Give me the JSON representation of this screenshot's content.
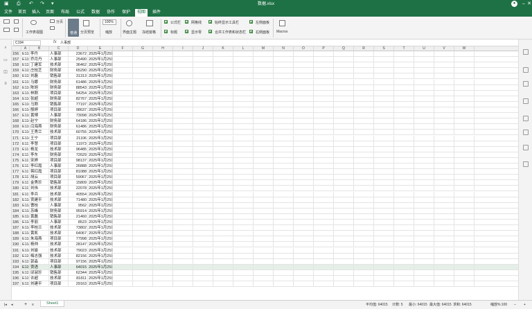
{
  "window": {
    "title": "数据.xlsx"
  },
  "menu": {
    "items": [
      "文件",
      "首页",
      "插入",
      "页面",
      "布局",
      "公式",
      "数据",
      "协作",
      "保护",
      "视图",
      "插件"
    ],
    "active_index": 9
  },
  "ribbon": {
    "labels": {
      "workbook_view": "工作表视图",
      "page_break": "分页",
      "normal": "普通",
      "page_layout": "分页预览",
      "zoom_value": "100%",
      "zoom": "缩放",
      "interface_theme": "界面主题",
      "freeze": "冻结窗格",
      "macros": "Macros"
    },
    "checks": [
      "公式栏",
      "网格线",
      "始终显示工具栏",
      "左侧面板",
      "标题",
      "显示零",
      "合并工作表和状态栏",
      "右侧面板"
    ]
  },
  "formula_bar": {
    "cell_ref": "C194",
    "fx": "fx",
    "value": "人事部"
  },
  "columns": [
    "A",
    "B",
    "C",
    "D",
    "E",
    "F",
    "G",
    "H",
    "I",
    "J",
    "K",
    "L",
    "M",
    "N",
    "O",
    "P",
    "Q",
    "R",
    "S",
    "T",
    "U",
    "V",
    "W"
  ],
  "rows": [
    [
      "156",
      "E1154",
      "李丹",
      "人事部",
      "23672",
      "2025年1月25日"
    ],
    [
      "157",
      "E1155",
      "乔月丹",
      "人事部",
      "25490",
      "2025年1月25日"
    ],
    [
      "158",
      "E1156",
      "丁建军",
      "技术部",
      "36462",
      "2025年1月25日"
    ],
    [
      "159",
      "E1157",
      "庄桂芝",
      "财务部",
      "65290",
      "2025年1月25日"
    ],
    [
      "160",
      "E1158",
      "刘磊",
      "销售部",
      "31313",
      "2025年1月25日"
    ],
    [
      "161",
      "E1159",
      "马娜",
      "财务部",
      "61486",
      "2025年1月25日"
    ],
    [
      "162",
      "E1160",
      "陈旭",
      "财务部",
      "88543",
      "2025年1月25日"
    ],
    [
      "163",
      "E1161",
      "林刚",
      "项目部",
      "54254",
      "2025年1月25日"
    ],
    [
      "164",
      "E1162",
      "张超",
      "财务部",
      "82767",
      "2025年1月25日"
    ],
    [
      "165",
      "E1163",
      "马刚",
      "销售部",
      "77197",
      "2025年1月25日"
    ],
    [
      "166",
      "E1164",
      "殷婷",
      "项目部",
      "98637",
      "2025年1月25日"
    ],
    [
      "167",
      "E1165",
      "黄博",
      "人事部",
      "73098",
      "2025年1月25日"
    ],
    [
      "168",
      "E1166",
      "赵宁",
      "财务部",
      "64186",
      "2025年1月25日"
    ],
    [
      "169",
      "E1167",
      "闫海燕",
      "财务部",
      "61486",
      "2025年1月25日"
    ],
    [
      "170",
      "E1168",
      "王秀兰",
      "技术部",
      "60755",
      "2025年1月25日"
    ],
    [
      "171",
      "E1169",
      "王宁",
      "项目部",
      "21106",
      "2025年1月25日"
    ],
    [
      "172",
      "E1170",
      "李慧",
      "项目部",
      "11973",
      "2025年1月25日"
    ],
    [
      "173",
      "E1171",
      "杨龙",
      "技术部",
      "96485",
      "2025年1月25日"
    ],
    [
      "174",
      "E1172",
      "李东",
      "财务部",
      "72629",
      "2025年1月25日"
    ],
    [
      "175",
      "E1173",
      "宋婷",
      "项目部",
      "98137",
      "2025年1月25日"
    ],
    [
      "176",
      "E1174",
      "李红霞",
      "人事部",
      "26888",
      "2025年1月25日"
    ],
    [
      "177",
      "E1175",
      "蒋红霞",
      "项目部",
      "81088",
      "2025年1月25日"
    ],
    [
      "178",
      "E1176",
      "胡云",
      "项目部",
      "59067",
      "2025年1月25日"
    ],
    [
      "179",
      "E1177",
      "金秀珍",
      "销售部",
      "15809",
      "2025年1月25日"
    ],
    [
      "180",
      "E1178",
      "刘伟",
      "技术部",
      "22078",
      "2025年1月25日"
    ],
    [
      "181",
      "E1179",
      "李兵",
      "技术部",
      "40554",
      "2025年1月25日"
    ],
    [
      "182",
      "E1180",
      "贾建平",
      "技术部",
      "71480",
      "2025年1月25日"
    ],
    [
      "183",
      "E1181",
      "曹桂",
      "人事部",
      "9562",
      "2025年1月25日"
    ],
    [
      "184",
      "E1182",
      "苏峰",
      "财务部",
      "95914",
      "2025年1月25日"
    ],
    [
      "185",
      "E1183",
      "黄磊",
      "销售部",
      "21460",
      "2025年1月25日"
    ],
    [
      "186",
      "E1184",
      "李丽",
      "人事部",
      "8523",
      "2025年1月25日"
    ],
    [
      "187",
      "E1185",
      "李桂兰",
      "技术部",
      "73802",
      "2025年1月25日"
    ],
    [
      "188",
      "E1186",
      "黄凯",
      "技术部",
      "64067",
      "2025年1月25日"
    ],
    [
      "189",
      "E1187",
      "朱海燕",
      "项目部",
      "77998",
      "2025年1月25日"
    ],
    [
      "190",
      "E1188",
      "杨帅",
      "技术部",
      "28147",
      "2025年1月25日"
    ],
    [
      "191",
      "E1189",
      "刘瑜",
      "技术部",
      "79023",
      "2025年1月25日"
    ],
    [
      "192",
      "E1190",
      "梅志强",
      "技术部",
      "82156",
      "2025年1月25日"
    ],
    [
      "193",
      "E1191",
      "郭淼",
      "项目部",
      "97156",
      "2025年1月25日"
    ],
    [
      "194",
      "E1192",
      "贾语",
      "人事部",
      "64015",
      "2025年1月25日"
    ],
    [
      "195",
      "E1193",
      "邱淑珍",
      "销售部",
      "62344",
      "2025年1月25日"
    ],
    [
      "196",
      "E1194",
      "许超",
      "技术部",
      "81811",
      "2025年1月25日"
    ],
    [
      "197",
      "E1195",
      "刘建平",
      "项目部",
      "29163",
      "2025年1月25日"
    ]
  ],
  "selected_row": "194",
  "status": {
    "sheet": "Sheet1",
    "sum": "平均值: 64015",
    "count": "计数: 5",
    "min": "最小: 64015",
    "max": "最大值: 64015",
    "total": "求和: 64015",
    "zoom": "缩放%:100"
  }
}
